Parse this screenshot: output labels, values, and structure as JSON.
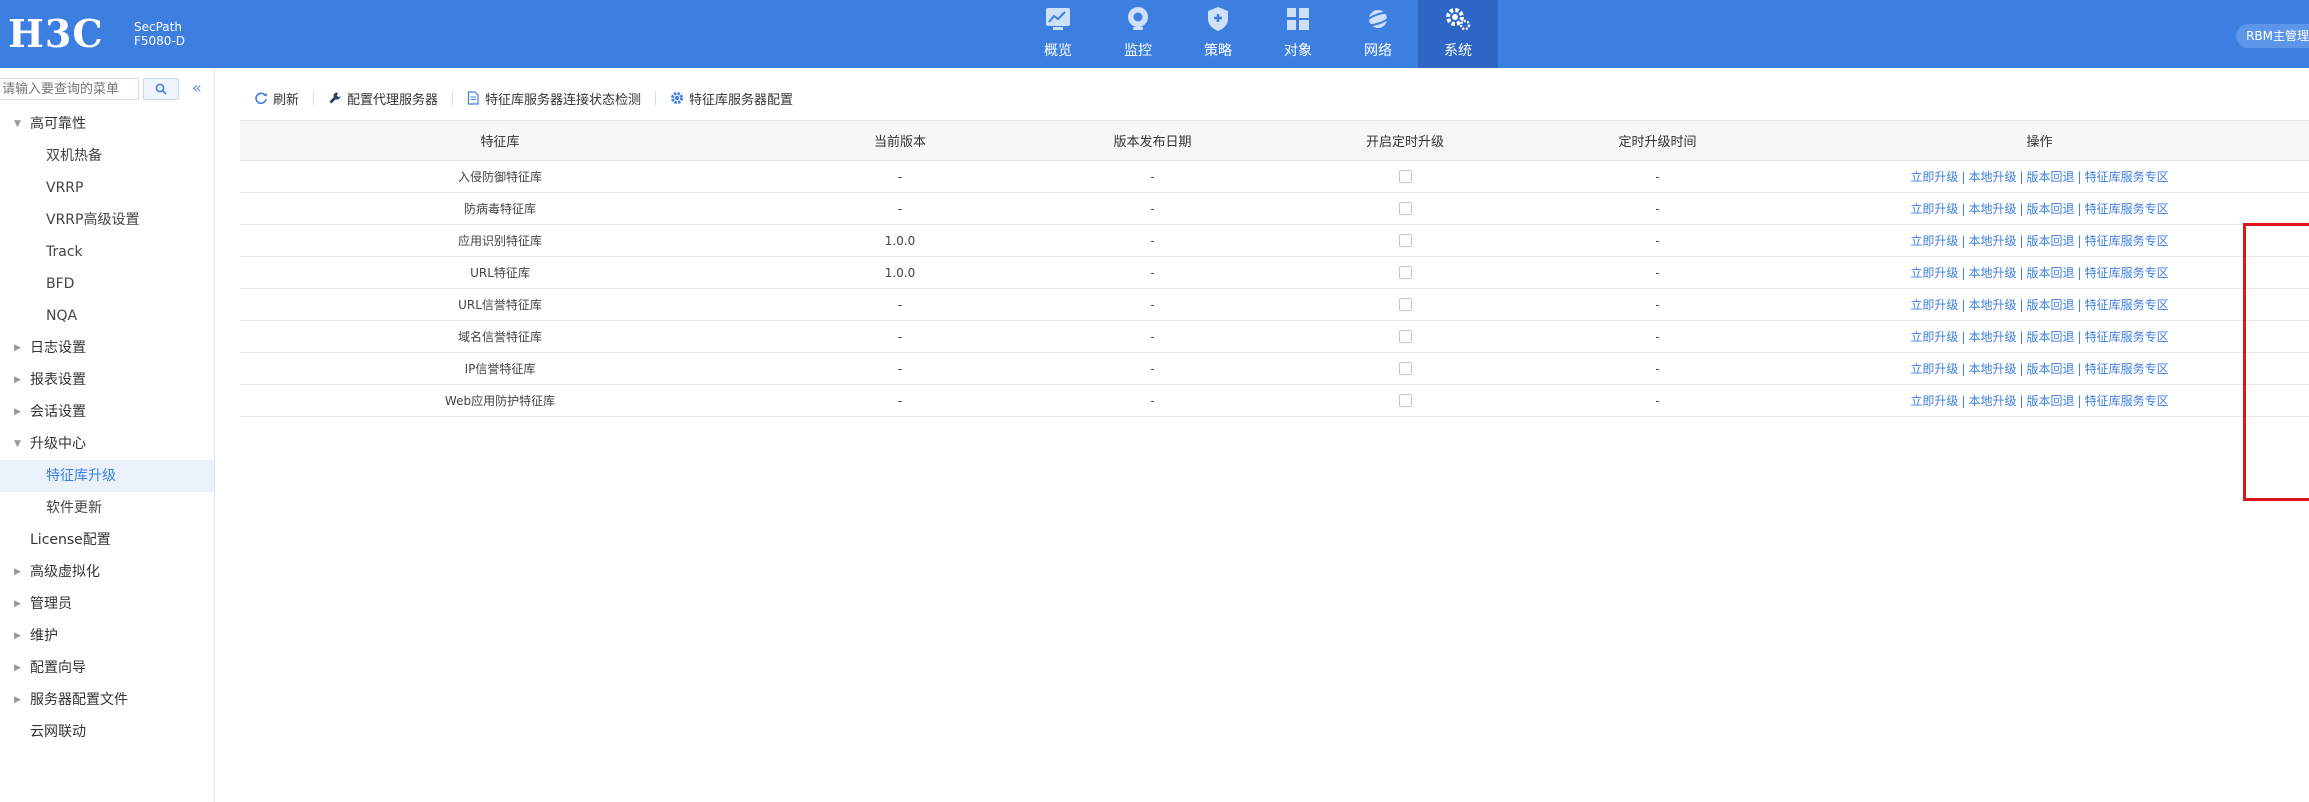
{
  "header": {
    "logo": "H3C",
    "product_line1": "SecPath",
    "product_line2": "F5080-D",
    "nav": [
      {
        "label": "概览",
        "icon": "overview-chart-icon"
      },
      {
        "label": "监控",
        "icon": "monitor-icon"
      },
      {
        "label": "策略",
        "icon": "policy-shield-icon"
      },
      {
        "label": "对象",
        "icon": "object-grid-icon"
      },
      {
        "label": "网络",
        "icon": "network-globe-icon"
      },
      {
        "label": "系统",
        "icon": "system-gear-icon",
        "active": true
      }
    ],
    "user": "RBM主管理"
  },
  "sidebar": {
    "search_placeholder": "请输入要查询的菜单",
    "collapse": "«",
    "items": [
      {
        "label": "高可靠性",
        "level": 1,
        "expanded": true
      },
      {
        "label": "双机热备",
        "level": 2
      },
      {
        "label": "VRRP",
        "level": 2
      },
      {
        "label": "VRRP高级设置",
        "level": 2
      },
      {
        "label": "Track",
        "level": 2
      },
      {
        "label": "BFD",
        "level": 2
      },
      {
        "label": "NQA",
        "level": 2
      },
      {
        "label": "日志设置",
        "level": 1
      },
      {
        "label": "报表设置",
        "level": 1
      },
      {
        "label": "会话设置",
        "level": 1
      },
      {
        "label": "升级中心",
        "level": 1,
        "expanded": true
      },
      {
        "label": "特征库升级",
        "level": 2,
        "active": true
      },
      {
        "label": "软件更新",
        "level": 2
      },
      {
        "label": "License配置",
        "level": 1,
        "leaf": true
      },
      {
        "label": "高级虚拟化",
        "level": 1
      },
      {
        "label": "管理员",
        "level": 1
      },
      {
        "label": "维护",
        "level": 1
      },
      {
        "label": "配置向导",
        "level": 1
      },
      {
        "label": "服务器配置文件",
        "level": 1
      },
      {
        "label": "云网联动",
        "level": 1,
        "leaf": true
      }
    ]
  },
  "toolbar": {
    "refresh": "刷新",
    "proxy": "配置代理服务器",
    "check": "特征库服务器连接状态检测",
    "server_config": "特征库服务器配置"
  },
  "table": {
    "headers": {
      "name": "特征库",
      "version": "当前版本",
      "date": "版本发布日期",
      "auto": "开启定时升级",
      "time": "定时升级时间",
      "ops": "操作"
    },
    "op_labels": {
      "upgrade_now": "立即升级",
      "local_upgrade": "本地升级",
      "rollback": "版本回退",
      "zone": "特征库服务专区"
    },
    "rows": [
      {
        "name": "入侵防御特征库",
        "version": "-",
        "date": "-",
        "time": "-"
      },
      {
        "name": "防病毒特征库",
        "version": "-",
        "date": "-",
        "time": "-"
      },
      {
        "name": "应用识别特征库",
        "version": "1.0.0",
        "date": "-",
        "time": "-"
      },
      {
        "name": "URL特征库",
        "version": "1.0.0",
        "date": "-",
        "time": "-"
      },
      {
        "name": "URL信誉特征库",
        "version": "-",
        "date": "-",
        "time": "-"
      },
      {
        "name": "域名信誉特征库",
        "version": "-",
        "date": "-",
        "time": "-"
      },
      {
        "name": "IP信誉特征库",
        "version": "-",
        "date": "-",
        "time": "-"
      },
      {
        "name": "Web应用防护特征库",
        "version": "-",
        "date": "-",
        "time": "-"
      }
    ]
  },
  "colors": {
    "header_bg": "#3d7fe0",
    "nav_active_bg": "#2d66c4",
    "link": "#3d7fe0",
    "highlight_box": "#e0141a"
  }
}
